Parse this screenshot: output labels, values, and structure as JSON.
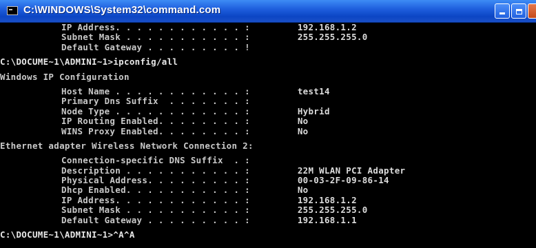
{
  "window": {
    "title": "C:\\WINDOWS\\System32\\command.com",
    "minimize_label": "",
    "maximize_label": ""
  },
  "console": {
    "top_entries": [
      {
        "key": "IP Address. . . . . . . . . . . . :",
        "value": "192.168.1.2"
      },
      {
        "key": "Subnet Mask . . . . . . . . . . . :",
        "value": "255.255.255.0"
      },
      {
        "key": "Default Gateway . . . . . . . . . !",
        "value": ""
      }
    ],
    "command_line": "C:\\DOCUME~1\\ADMINI~1>ipconfig/all",
    "section_windows_ip": "Windows IP Configuration",
    "ip_config_entries": [
      {
        "key": "Host Name . . . . . . . . . . . . :",
        "value": "test14"
      },
      {
        "key": "Primary Dns Suffix  . . . . . . . :",
        "value": ""
      },
      {
        "key": "Node Type . . . . . . . . . . . . :",
        "value": "Hybrid"
      },
      {
        "key": "IP Routing Enabled. . . . . . . . :",
        "value": "No"
      },
      {
        "key": "WINS Proxy Enabled. . . . . . . . :",
        "value": "No"
      }
    ],
    "section_adapter": "Ethernet adapter Wireless Network Connection 2:",
    "adapter_entries": [
      {
        "key": "Connection-specific DNS Suffix  . :",
        "value": ""
      },
      {
        "key": "Description . . . . . . . . . . . :",
        "value": "22M WLAN PCI Adapter"
      },
      {
        "key": "Physical Address. . . . . . . . . :",
        "value": "00-03-2F-09-86-14"
      },
      {
        "key": "Dhcp Enabled. . . . . . . . . . . :",
        "value": "No"
      },
      {
        "key": "IP Address. . . . . . . . . . . . :",
        "value": "192.168.1.2"
      },
      {
        "key": "Subnet Mask . . . . . . . . . . . :",
        "value": "255.255.255.0"
      },
      {
        "key": "Default Gateway . . . . . . . . . :",
        "value": "192.168.1.1"
      }
    ],
    "final_prompt": "C:\\DOCUME~1\\ADMINI~1>^A^A"
  },
  "colors": {
    "console_background": "#000000",
    "console_text": "#c0c0c0",
    "titlebar": "#1f5fde"
  }
}
